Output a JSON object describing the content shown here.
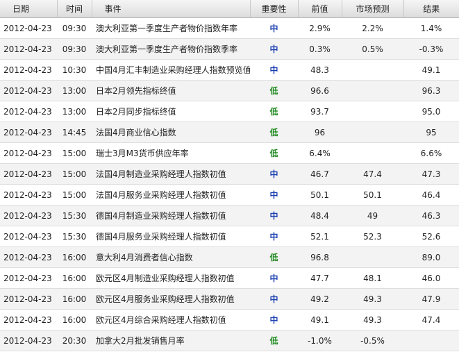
{
  "calendar": {
    "columns": {
      "date": "日期",
      "time": "时间",
      "event": "事件",
      "importance": "重要性",
      "previous": "前值",
      "forecast": "市场预测",
      "result": "结果"
    },
    "importance_colors": {
      "中": "#1a3fb0",
      "低": "#1f8a1f"
    },
    "rows": [
      {
        "date": "2012-04-23",
        "time": "09:30",
        "event": "澳大利亚第一季度生产者物价指数年率",
        "importance": "中",
        "previous": "2.9%",
        "forecast": "2.2%",
        "result": "1.4%"
      },
      {
        "date": "2012-04-23",
        "time": "09:30",
        "event": "澳大利亚第一季度生产者物价指数季率",
        "importance": "中",
        "previous": "0.3%",
        "forecast": "0.5%",
        "result": "-0.3%"
      },
      {
        "date": "2012-04-23",
        "time": "10:30",
        "event": "中国4月汇丰制造业采购经理人指数预览值",
        "importance": "中",
        "previous": "48.3",
        "forecast": "",
        "result": "49.1"
      },
      {
        "date": "2012-04-23",
        "time": "13:00",
        "event": "日本2月领先指标终值",
        "importance": "低",
        "previous": "96.6",
        "forecast": "",
        "result": "96.3"
      },
      {
        "date": "2012-04-23",
        "time": "13:00",
        "event": "日本2月同步指标终值",
        "importance": "低",
        "previous": "93.7",
        "forecast": "",
        "result": "95.0"
      },
      {
        "date": "2012-04-23",
        "time": "14:45",
        "event": "法国4月商业信心指数",
        "importance": "低",
        "previous": "96",
        "forecast": "",
        "result": "95"
      },
      {
        "date": "2012-04-23",
        "time": "15:00",
        "event": "瑞士3月M3货币供应年率",
        "importance": "低",
        "previous": "6.4%",
        "forecast": "",
        "result": "6.6%"
      },
      {
        "date": "2012-04-23",
        "time": "15:00",
        "event": "法国4月制造业采购经理人指数初值",
        "importance": "中",
        "previous": "46.7",
        "forecast": "47.4",
        "result": "47.3"
      },
      {
        "date": "2012-04-23",
        "time": "15:00",
        "event": "法国4月服务业采购经理人指数初值",
        "importance": "中",
        "previous": "50.1",
        "forecast": "50.1",
        "result": "46.4"
      },
      {
        "date": "2012-04-23",
        "time": "15:30",
        "event": "德国4月制造业采购经理人指数初值",
        "importance": "中",
        "previous": "48.4",
        "forecast": "49",
        "result": "46.3"
      },
      {
        "date": "2012-04-23",
        "time": "15:30",
        "event": "德国4月服务业采购经理人指数初值",
        "importance": "中",
        "previous": "52.1",
        "forecast": "52.3",
        "result": "52.6"
      },
      {
        "date": "2012-04-23",
        "time": "16:00",
        "event": "意大利4月消费者信心指数",
        "importance": "低",
        "previous": "96.8",
        "forecast": "",
        "result": "89.0"
      },
      {
        "date": "2012-04-23",
        "time": "16:00",
        "event": "欧元区4月制造业采购经理人指数初值",
        "importance": "中",
        "previous": "47.7",
        "forecast": "48.1",
        "result": "46.0"
      },
      {
        "date": "2012-04-23",
        "time": "16:00",
        "event": "欧元区4月服务业采购经理人指数初值",
        "importance": "中",
        "previous": "49.2",
        "forecast": "49.3",
        "result": "47.9"
      },
      {
        "date": "2012-04-23",
        "time": "16:00",
        "event": "欧元区4月综合采购经理人指数初值",
        "importance": "中",
        "previous": "49.1",
        "forecast": "49.3",
        "result": "47.4"
      },
      {
        "date": "2012-04-23",
        "time": "20:30",
        "event": "加拿大2月批发销售月率",
        "importance": "低",
        "previous": "-1.0%",
        "forecast": "-0.5%",
        "result": ""
      }
    ]
  }
}
